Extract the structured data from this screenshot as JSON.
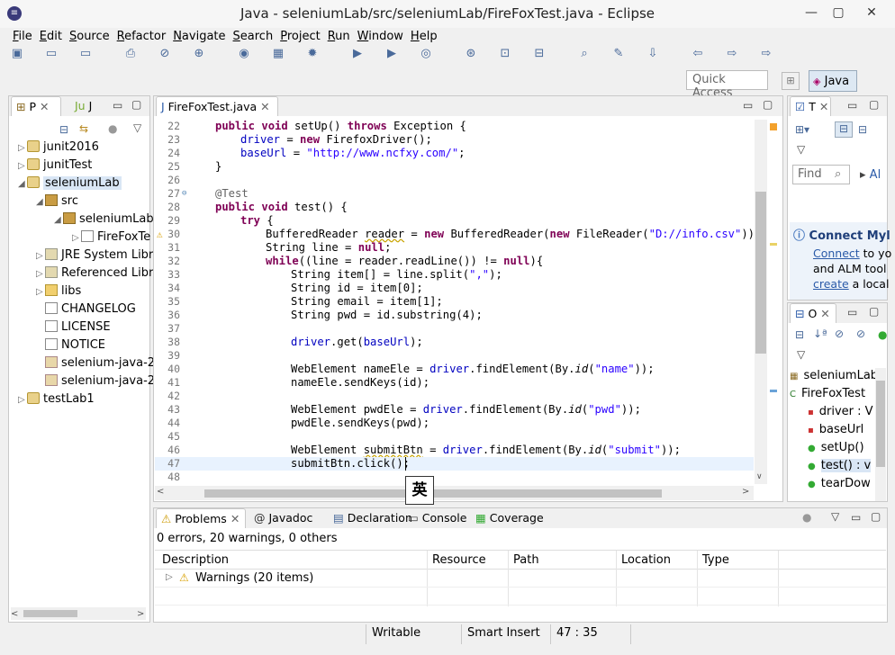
{
  "window": {
    "title": "Java - seleniumLab/src/seleniumLab/FireFoxTest.java - Eclipse"
  },
  "menu": [
    "File",
    "Edit",
    "Source",
    "Refactor",
    "Navigate",
    "Search",
    "Project",
    "Run",
    "Window",
    "Help"
  ],
  "quick_access": {
    "placeholder": "Quick Access"
  },
  "perspective": {
    "label": "Java"
  },
  "package_explorer": {
    "tabs": [
      "P",
      "J"
    ],
    "items": [
      {
        "label": "junit2016",
        "indent": 0,
        "twisty": "▷",
        "icon": "proj"
      },
      {
        "label": "junitTest",
        "indent": 0,
        "twisty": "▷",
        "icon": "proj"
      },
      {
        "label": "seleniumLab",
        "indent": 0,
        "twisty": "◢",
        "icon": "proj",
        "selected": true
      },
      {
        "label": "src",
        "indent": 1,
        "twisty": "◢",
        "icon": "pkg"
      },
      {
        "label": "seleniumLab",
        "indent": 2,
        "twisty": "◢",
        "icon": "pkg"
      },
      {
        "label": "FireFoxTe",
        "indent": 3,
        "twisty": "▷",
        "icon": "file"
      },
      {
        "label": "JRE System Libr",
        "indent": 1,
        "twisty": "▷",
        "icon": "lib"
      },
      {
        "label": "Referenced Libr",
        "indent": 1,
        "twisty": "▷",
        "icon": "lib"
      },
      {
        "label": "libs",
        "indent": 1,
        "twisty": "▷",
        "icon": "folder"
      },
      {
        "label": "CHANGELOG",
        "indent": 1,
        "twisty": "",
        "icon": "file"
      },
      {
        "label": "LICENSE",
        "indent": 1,
        "twisty": "",
        "icon": "file"
      },
      {
        "label": "NOTICE",
        "indent": 1,
        "twisty": "",
        "icon": "file"
      },
      {
        "label": "selenium-java-2",
        "indent": 1,
        "twisty": "",
        "icon": "jar"
      },
      {
        "label": "selenium-java-2",
        "indent": 1,
        "twisty": "",
        "icon": "jar"
      },
      {
        "label": "testLab1",
        "indent": 0,
        "twisty": "▷",
        "icon": "proj"
      }
    ]
  },
  "editor": {
    "tab": "FireFoxTest.java",
    "lines": [
      {
        "n": "22",
        "html": "<span class='kw'>public void</span> setUp() <span class='kw'>throws</span> Exception {",
        "ind": 0
      },
      {
        "n": "23",
        "html": "<span class='fd'>driver</span> = <span class='kw'>new</span> FirefoxDriver();",
        "ind": 1
      },
      {
        "n": "24",
        "html": "<span class='fd'>baseUrl</span> = <span class='st'>\"http://www.ncfxy.com/\"</span>;",
        "ind": 1
      },
      {
        "n": "25",
        "html": "}",
        "ind": 0
      },
      {
        "n": "26",
        "html": "",
        "ind": 0
      },
      {
        "n": "27",
        "html": "<span class='an'>@Test</span>",
        "ind": 0
      },
      {
        "n": "28",
        "html": "<span class='kw'>public void</span> test() {",
        "ind": 0
      },
      {
        "n": "29",
        "html": "<span class='kw'>try</span> {",
        "ind": 1
      },
      {
        "n": "30",
        "html": "BufferedReader <span class='sq'>reader</span> = <span class='kw'>new</span> BufferedReader(<span class='kw'>new</span> FileReader(<span class='st'>\"D://info.csv\"</span>));",
        "ind": 2
      },
      {
        "n": "31",
        "html": "String line = <span class='kw'>null</span>;",
        "ind": 2
      },
      {
        "n": "32",
        "html": "<span class='kw'>while</span>((line = reader.readLine()) != <span class='kw'>null</span>){",
        "ind": 2
      },
      {
        "n": "33",
        "html": "String item[] = line.split(<span class='st'>\",\"</span>);",
        "ind": 3
      },
      {
        "n": "34",
        "html": "String id = item[0];",
        "ind": 3
      },
      {
        "n": "35",
        "html": "String email = item[1];",
        "ind": 3
      },
      {
        "n": "36",
        "html": "String pwd = id.substring(4);",
        "ind": 3
      },
      {
        "n": "37",
        "html": "",
        "ind": 3
      },
      {
        "n": "38",
        "html": "<span class='fd'>driver</span>.get(<span class='fd'>baseUrl</span>);",
        "ind": 3
      },
      {
        "n": "39",
        "html": "",
        "ind": 3
      },
      {
        "n": "40",
        "html": "WebElement nameEle = <span class='fd'>driver</span>.findElement(By.<span class='it'>id</span>(<span class='st'>\"name\"</span>));",
        "ind": 3
      },
      {
        "n": "41",
        "html": "nameEle.sendKeys(id);",
        "ind": 3
      },
      {
        "n": "42",
        "html": "",
        "ind": 3
      },
      {
        "n": "43",
        "html": "WebElement pwdEle = <span class='fd'>driver</span>.findElement(By.<span class='it'>id</span>(<span class='st'>\"pwd\"</span>));",
        "ind": 3
      },
      {
        "n": "44",
        "html": "pwdEle.sendKeys(pwd);",
        "ind": 3
      },
      {
        "n": "45",
        "html": "",
        "ind": 3
      },
      {
        "n": "46",
        "html": "WebElement <span class='sq'>submitBtn</span> = <span class='fd'>driver</span>.findElement(By.<span class='it'>id</span>(<span class='st'>\"submit\"</span>));",
        "ind": 3
      },
      {
        "n": "47",
        "html": "submitBtn.click();",
        "ind": 3
      },
      {
        "n": "48",
        "html": "",
        "ind": 3
      }
    ],
    "ime_char": "英"
  },
  "task_view": {
    "tab": "T",
    "find_placeholder": "Find",
    "all_label": "Al",
    "connect_title": "Connect Myl",
    "connect_text1": "Connect",
    "connect_text2": " to yo",
    "connect_text3": "and ALM tool",
    "connect_text4": "create",
    "connect_text5": " a local"
  },
  "outline": {
    "tab": "O",
    "items": [
      {
        "label": "seleniumLab",
        "kind": "pkg"
      },
      {
        "label": "FireFoxTest",
        "kind": "class"
      },
      {
        "label": "driver : V",
        "kind": "field"
      },
      {
        "label": "baseUrl",
        "kind": "field"
      },
      {
        "label": "setUp()",
        "kind": "method"
      },
      {
        "label": "test() : v",
        "kind": "method"
      },
      {
        "label": "tearDow",
        "kind": "method"
      }
    ]
  },
  "problems": {
    "tabs": [
      "Problems",
      "Javadoc",
      "Declaration",
      "Console",
      "Coverage"
    ],
    "summary": "0 errors, 20 warnings, 0 others",
    "columns": [
      "Description",
      "Resource",
      "Path",
      "Location",
      "Type"
    ],
    "row": "Warnings (20 items)"
  },
  "status": {
    "writable": "Writable",
    "insert": "Smart Insert",
    "position": "47 : 35"
  }
}
